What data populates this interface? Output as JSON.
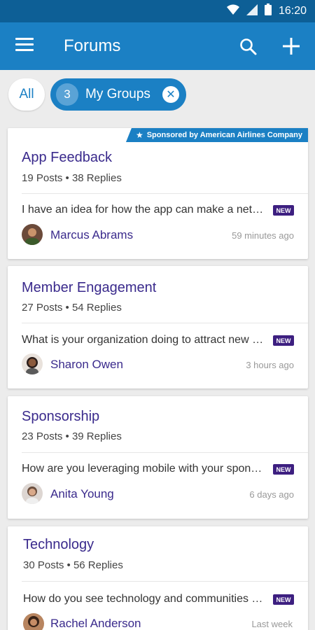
{
  "status_bar": {
    "time": "16:20"
  },
  "app_bar": {
    "title": "Forums"
  },
  "filters": {
    "all_label": "All",
    "groups_count": "3",
    "groups_label": "My Groups"
  },
  "sponsor": {
    "text": "Sponsored by American Airlines Company"
  },
  "cards": [
    {
      "title": "App Feedback",
      "stats": "19 Posts  •  38 Replies",
      "preview": "I have an idea for how the app can make a network...",
      "badge": "NEW",
      "author": "Marcus Abrams",
      "time": "59 minutes ago"
    },
    {
      "title": "Member Engagement",
      "stats": "27 Posts  •  54 Replies",
      "preview": "What is your organization doing to attract new members...",
      "badge": "NEW",
      "author": "Sharon Owen",
      "time": "3 hours ago"
    },
    {
      "title": "Sponsorship",
      "stats": "23 Posts  •  39 Replies",
      "preview": "How are you leveraging mobile with your sponsors...",
      "badge": "NEW",
      "author": "Anita Young",
      "time": "6 days ago"
    },
    {
      "title": "Technology",
      "stats": "30 Posts  •  56 Replies",
      "preview": "How do you see technology and communities evolving...",
      "badge": "NEW",
      "author": "Rachel Anderson",
      "time": "Last week"
    }
  ]
}
